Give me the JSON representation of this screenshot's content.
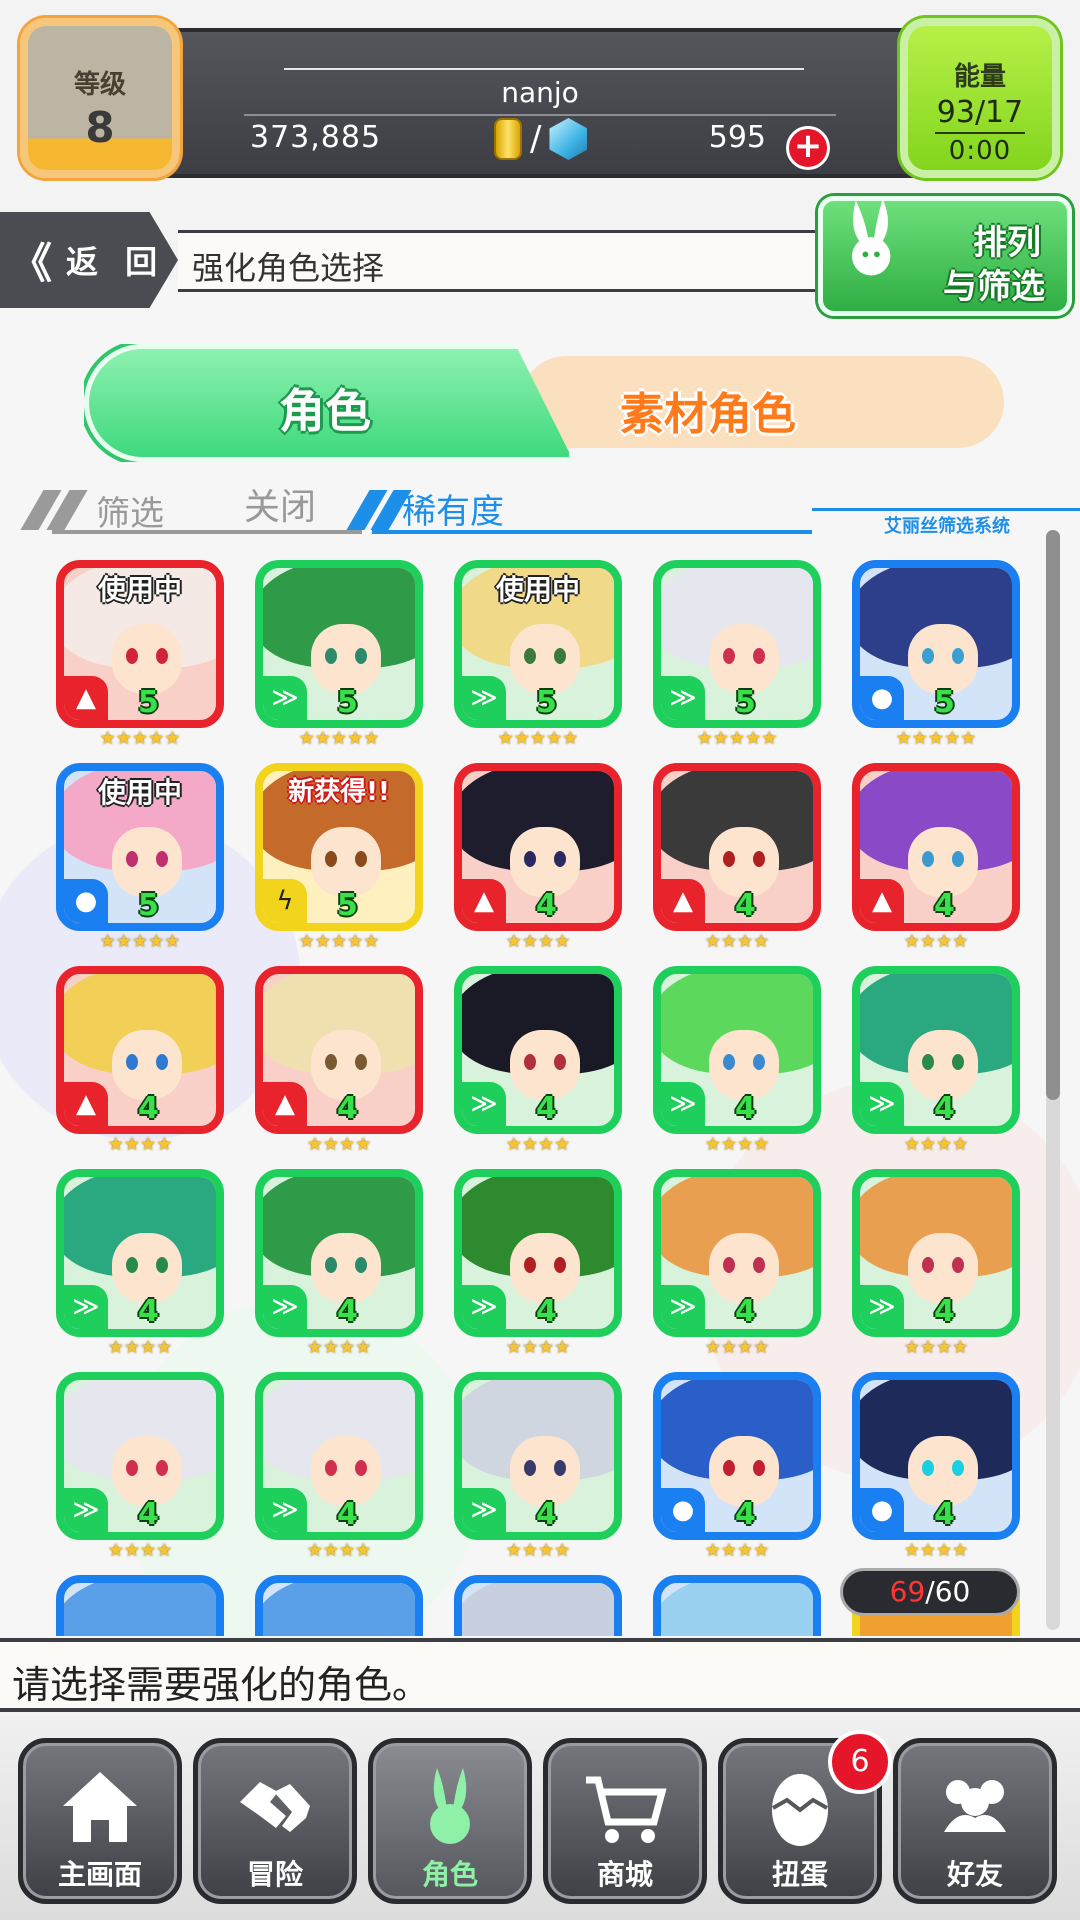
{
  "status": {
    "level_label": "等级",
    "level_value": "8",
    "player_name": "nanjo",
    "gold": "373,885",
    "separator": "/",
    "gems": "595",
    "add_icon": "plus-icon",
    "energy_label": "能量",
    "energy_value": "93/17",
    "energy_timer": "0:00"
  },
  "header": {
    "back_chevron": "《",
    "back_label": "返 回",
    "title": "强化角色选择",
    "sort_line1": "排列",
    "sort_line2": "与筛选"
  },
  "tabs": {
    "character": "角色",
    "material": "素材角色"
  },
  "filter": {
    "filter_label": "筛选",
    "close_label": "关闭",
    "rarity_label": "稀有度",
    "system_label": "艾丽丝筛选系统"
  },
  "colors": {
    "fire": "#e8232b",
    "wind": "#1fcf5c",
    "water": "#1a7ff0",
    "thunder": "#f2d41c"
  },
  "grid": {
    "cards": [
      {
        "element": "fire",
        "rarity": "5",
        "stars": "★★★★★",
        "badge": "使用中",
        "hair": "#f4e9e4",
        "eyes": "#d0243a"
      },
      {
        "element": "wind",
        "rarity": "5",
        "stars": "★★★★★",
        "badge": "",
        "hair": "#2f9a48",
        "eyes": "#2a8a6a"
      },
      {
        "element": "wind",
        "rarity": "5",
        "stars": "★★★★★",
        "badge": "使用中",
        "hair": "#f1d98a",
        "eyes": "#3b7a3b"
      },
      {
        "element": "wind",
        "rarity": "5",
        "stars": "★★★★★",
        "badge": "",
        "hair": "#e6e6ee",
        "eyes": "#d03050"
      },
      {
        "element": "water",
        "rarity": "5",
        "stars": "★★★★★",
        "badge": "",
        "hair": "#2d3e8a",
        "eyes": "#3aa0d0"
      },
      {
        "element": "water",
        "rarity": "5",
        "stars": "★★★★★",
        "badge": "使用中",
        "hair": "#f4a9c8",
        "eyes": "#c03070"
      },
      {
        "element": "thunder",
        "rarity": "5",
        "stars": "★★★★★",
        "badge": "新获得!!",
        "hair": "#c46a2a",
        "eyes": "#8a4a1a"
      },
      {
        "element": "fire",
        "rarity": "4",
        "stars": "★★★★",
        "badge": "",
        "hair": "#1d1d2e",
        "eyes": "#2a2a60"
      },
      {
        "element": "fire",
        "rarity": "4",
        "stars": "★★★★",
        "badge": "",
        "hair": "#3a3a3a",
        "eyes": "#b02020"
      },
      {
        "element": "fire",
        "rarity": "4",
        "stars": "★★★★",
        "badge": "",
        "hair": "#8a4ac8",
        "eyes": "#3a9ad0"
      },
      {
        "element": "fire",
        "rarity": "4",
        "stars": "★★★★",
        "badge": "",
        "hair": "#f2cf56",
        "eyes": "#2f7ad0"
      },
      {
        "element": "fire",
        "rarity": "4",
        "stars": "★★★★",
        "badge": "",
        "hair": "#f0e0b0",
        "eyes": "#7a5a30"
      },
      {
        "element": "wind",
        "rarity": "4",
        "stars": "★★★★",
        "badge": "",
        "hair": "#1a1a26",
        "eyes": "#b03040"
      },
      {
        "element": "wind",
        "rarity": "4",
        "stars": "★★★★",
        "badge": "",
        "hair": "#5cd85c",
        "eyes": "#3a8ad0"
      },
      {
        "element": "wind",
        "rarity": "4",
        "stars": "★★★★",
        "badge": "",
        "hair": "#2aa880",
        "eyes": "#2a8a4a"
      },
      {
        "element": "wind",
        "rarity": "4",
        "stars": "★★★★",
        "badge": "",
        "hair": "#2aa880",
        "eyes": "#2a8a4a"
      },
      {
        "element": "wind",
        "rarity": "4",
        "stars": "★★★★",
        "badge": "",
        "hair": "#2f9a48",
        "eyes": "#2a8a6a"
      },
      {
        "element": "wind",
        "rarity": "4",
        "stars": "★★★★",
        "badge": "",
        "hair": "#2e8a2e",
        "eyes": "#b02020"
      },
      {
        "element": "wind",
        "rarity": "4",
        "stars": "★★★★",
        "badge": "",
        "hair": "#e8a050",
        "eyes": "#c03050"
      },
      {
        "element": "wind",
        "rarity": "4",
        "stars": "★★★★",
        "badge": "",
        "hair": "#e8a050",
        "eyes": "#c03050"
      },
      {
        "element": "wind",
        "rarity": "4",
        "stars": "★★★★",
        "badge": "",
        "hair": "#e6e6ee",
        "eyes": "#d03050"
      },
      {
        "element": "wind",
        "rarity": "4",
        "stars": "★★★★",
        "badge": "",
        "hair": "#e6e6ee",
        "eyes": "#d03050"
      },
      {
        "element": "wind",
        "rarity": "4",
        "stars": "★★★★",
        "badge": "",
        "hair": "#cfd6e0",
        "eyes": "#3a3a6a"
      },
      {
        "element": "water",
        "rarity": "4",
        "stars": "★★★★",
        "badge": "",
        "hair": "#2a5ec8",
        "eyes": "#c02030"
      },
      {
        "element": "water",
        "rarity": "4",
        "stars": "★★★★",
        "badge": "",
        "hair": "#1d2a5a",
        "eyes": "#1ad0e0"
      },
      {
        "element": "water",
        "rarity": "",
        "stars": "",
        "badge": "",
        "hair": "#5aa0e8",
        "eyes": "#2a5ec8"
      },
      {
        "element": "water",
        "rarity": "",
        "stars": "",
        "badge": "",
        "hair": "#5aa0e8",
        "eyes": "#2a5ec8"
      },
      {
        "element": "water",
        "rarity": "",
        "stars": "",
        "badge": "",
        "hair": "#c8d0e0",
        "eyes": "#2a5ec8"
      },
      {
        "element": "water",
        "rarity": "",
        "stars": "",
        "badge": "",
        "hair": "#9ad0f0",
        "eyes": "#2a5ec8"
      },
      {
        "element": "thunder",
        "rarity": "",
        "stars": "",
        "badge": "",
        "hair": "#f0a030",
        "eyes": "#8a4a1a"
      }
    ]
  },
  "count": {
    "current": "69",
    "separator": "/",
    "max": "60"
  },
  "message": "请选择需要强化的角色。",
  "nav": {
    "home": "主画面",
    "adventure": "冒险",
    "character": "角色",
    "shop": "商城",
    "gacha": "扭蛋",
    "friends": "好友",
    "gacha_badge": "6"
  }
}
